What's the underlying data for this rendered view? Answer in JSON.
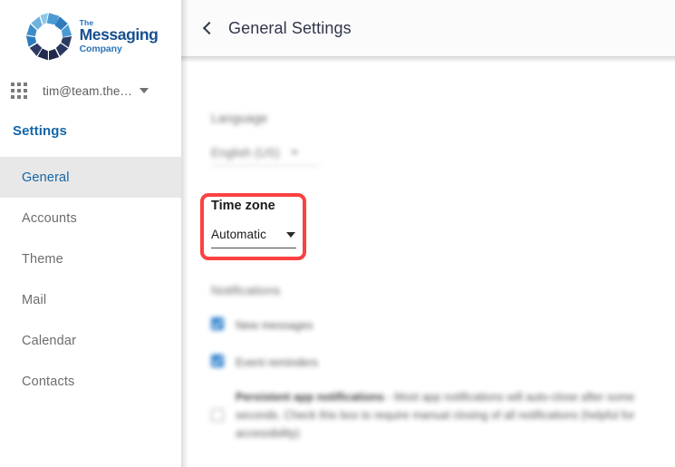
{
  "sidebar": {
    "logo": {
      "line1": "The",
      "line2": "Messaging",
      "line3": "Company",
      "icon": "messaging-company-logo"
    },
    "account": {
      "apps_icon": "app-grid-icon",
      "email": "tim@team.the…",
      "caret_icon": "chevron-down-icon"
    },
    "heading": "Settings",
    "items": [
      {
        "label": "General",
        "active": true
      },
      {
        "label": "Accounts",
        "active": false
      },
      {
        "label": "Theme",
        "active": false
      },
      {
        "label": "Mail",
        "active": false
      },
      {
        "label": "Calendar",
        "active": false
      },
      {
        "label": "Contacts",
        "active": false
      }
    ]
  },
  "header": {
    "back_icon": "back-chevron-icon",
    "title": "General Settings"
  },
  "main": {
    "language": {
      "label": "Language",
      "value": "English (US)",
      "caret_icon": "chevron-down-icon"
    },
    "timezone": {
      "label": "Time zone",
      "value": "Automatic",
      "caret_icon": "chevron-down-icon",
      "highlight_color": "#fb4141"
    },
    "notifications": {
      "label": "Notifications",
      "options": [
        {
          "label": "New messages",
          "checked": true
        },
        {
          "label": "Event reminders",
          "checked": true
        }
      ],
      "persistent": {
        "checked": false,
        "title": "Persistent app notifications",
        "description": " - Most app notifications will auto-close after some seconds. Check this box to require manual closing of all notifications (helpful for accessibility)"
      }
    }
  },
  "colors": {
    "accent_blue": "#1565a8",
    "logo_blue": "#17508f",
    "highlight_red": "#fb4141",
    "checkbox_blue": "#1a73c8",
    "sidebar_active_bg": "#e8e8e8",
    "header_bg": "#fbfbfb"
  }
}
